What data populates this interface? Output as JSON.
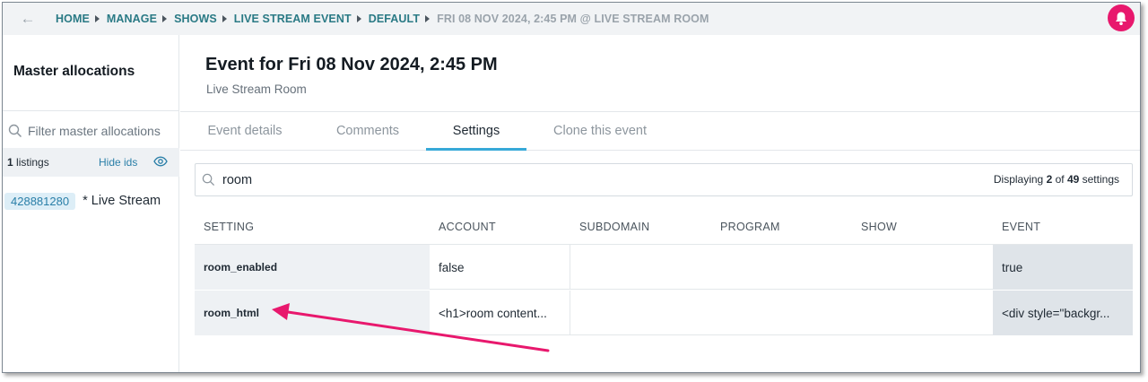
{
  "breadcrumbs": [
    {
      "label": "HOME"
    },
    {
      "label": "MANAGE"
    },
    {
      "label": "SHOWS"
    },
    {
      "label": "LIVE STREAM EVENT"
    },
    {
      "label": "DEFAULT"
    },
    {
      "label": "FRI 08 NOV 2024, 2:45 PM @ LIVE STREAM ROOM"
    }
  ],
  "colors": {
    "accent": "#2a7a85",
    "bell": "#e8186d",
    "active_tab": "#37a9d8",
    "arrow": "#e8186d"
  },
  "icons": {
    "back": "arrow-left-icon",
    "notifications": "bell-icon",
    "search": "search-icon",
    "eye": "eye-icon"
  },
  "sidebar": {
    "title": "Master allocations",
    "filter_placeholder": "Filter master allocations",
    "listings_count": "1",
    "listings_label": " listings",
    "hide_ids_label": "Hide ids",
    "items": [
      {
        "id": "428881280",
        "name": "* Live Stream"
      }
    ]
  },
  "event": {
    "title": "Event for Fri 08 Nov 2024, 2:45 PM",
    "subtitle": "Live Stream Room"
  },
  "tabs": [
    {
      "label": "Event details",
      "active": false
    },
    {
      "label": "Comments",
      "active": false
    },
    {
      "label": "Settings",
      "active": true
    },
    {
      "label": "Clone this event",
      "active": false
    }
  ],
  "settings": {
    "search_value": "room",
    "displaying_prefix": "Displaying ",
    "displaying_shown": "2",
    "displaying_of": " of ",
    "displaying_total": "49",
    "displaying_suffix": " settings",
    "columns": [
      "SETTING",
      "ACCOUNT",
      "SUBDOMAIN",
      "PROGRAM",
      "SHOW",
      "EVENT"
    ],
    "rows": [
      {
        "setting": "room_enabled",
        "account": "false",
        "subdomain": "",
        "program": "",
        "show": "",
        "event": "true"
      },
      {
        "setting": "room_html",
        "account": "<h1>room content...",
        "subdomain": "",
        "program": "",
        "show": "",
        "event": "<div style=\"backgr..."
      }
    ]
  }
}
